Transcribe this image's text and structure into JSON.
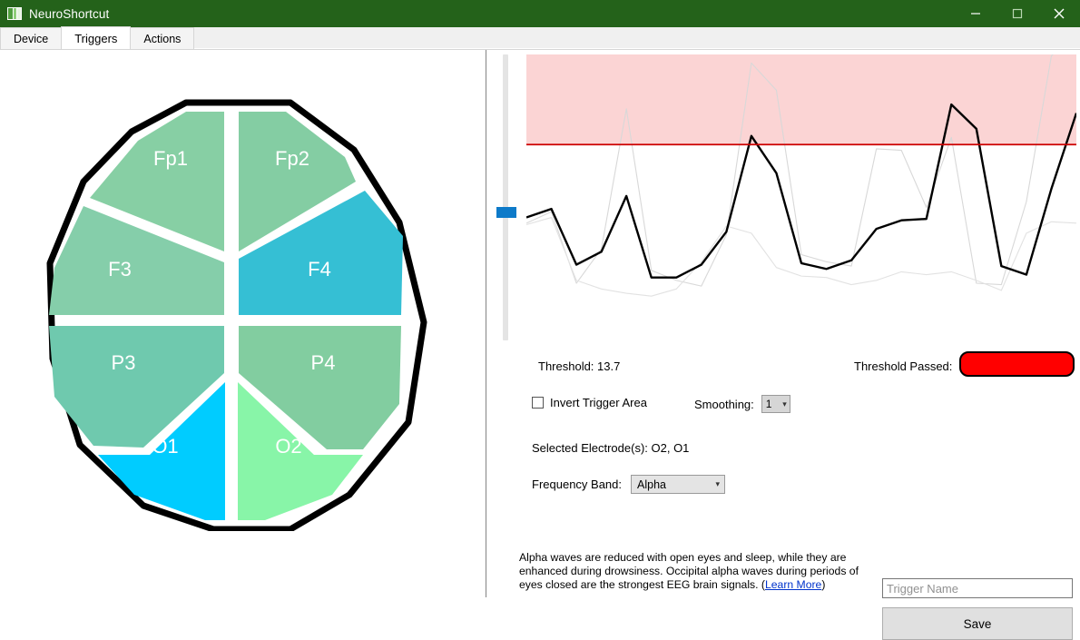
{
  "window": {
    "title": "NeuroShortcut",
    "icon": "app-window-icon",
    "titlebar_color": "#24621a",
    "controls": {
      "minimize": "minimize-icon",
      "maximize": "maximize-icon",
      "close": "close-icon"
    }
  },
  "tabs": [
    {
      "label": "Device",
      "selected": false
    },
    {
      "label": "Triggers",
      "selected": true
    },
    {
      "label": "Actions",
      "selected": false
    }
  ],
  "head_map": {
    "outline_color": "#000000",
    "electrodes": [
      {
        "name": "Fp1",
        "color": "#87cfa4",
        "selected": false
      },
      {
        "name": "Fp2",
        "color": "#84cda3",
        "selected": false
      },
      {
        "name": "F3",
        "color": "#85ceaa",
        "selected": false
      },
      {
        "name": "F4",
        "color": "#35bfd4",
        "selected": false
      },
      {
        "name": "P3",
        "color": "#6fc9ae",
        "selected": false
      },
      {
        "name": "P4",
        "color": "#82cda0",
        "selected": false
      },
      {
        "name": "O1",
        "color": "#00ccff",
        "selected": true
      },
      {
        "name": "O2",
        "color": "#88f5a8",
        "selected": true
      }
    ]
  },
  "chart_data": {
    "type": "line",
    "title": "",
    "xlabel": "",
    "ylabel": "",
    "grid": false,
    "legend": "none",
    "ylim": [
      0,
      20
    ],
    "threshold": 13.7,
    "threshold_line_color": "#cc0000",
    "trigger_area_color": "#fbd4d4",
    "trigger_area_above_threshold": true,
    "series": [
      {
        "name": "signal",
        "color": "#000000",
        "width": 2.4,
        "values": [
          8.6,
          9.2,
          5.3,
          6.2,
          10.1,
          4.4,
          4.4,
          5.3,
          7.6,
          14.3,
          11.7,
          5.4,
          5.0,
          5.6,
          7.8,
          8.4,
          8.5,
          16.5,
          14.8,
          5.2,
          4.6,
          10.6,
          15.9
        ]
      },
      {
        "name": "raw-a",
        "color": "#d8d8d8",
        "width": 1.1,
        "values": [
          8.2,
          9.0,
          4.0,
          6.4,
          16.2,
          4.9,
          4.2,
          3.8,
          7.4,
          19.4,
          17.5,
          6.0,
          5.5,
          5.2,
          13.4,
          13.3,
          9.3,
          14.2,
          4.0,
          3.9,
          9.7,
          19.9,
          21.5
        ]
      },
      {
        "name": "raw-b",
        "color": "#e2e2e2",
        "width": 1.1,
        "values": [
          8.1,
          8.6,
          4.2,
          3.6,
          3.3,
          3.1,
          3.6,
          5.5,
          8.0,
          7.5,
          5.1,
          4.5,
          4.4,
          3.9,
          4.2,
          4.8,
          4.6,
          4.8,
          4.2,
          3.5,
          7.5,
          8.3,
          8.2
        ]
      }
    ]
  },
  "slider": {
    "name": "threshold-slider",
    "value": 13.7,
    "thumb_color": "#0d7ac9",
    "track_color": "#e4e4e4"
  },
  "controls": {
    "threshold_label": "Threshold: 13.7",
    "threshold_passed_label": "Threshold Passed:",
    "indicator_color": "#ff0000",
    "invert_label": "Invert Trigger Area",
    "invert_checked": false,
    "smoothing_label": "Smoothing:",
    "smoothing_value": "1",
    "selected_electrodes_label": "Selected Electrode(s): O2, O1",
    "frequency_band_label": "Frequency Band:",
    "frequency_band_value": "Alpha",
    "description_part1": "Alpha waves are reduced with open eyes and sleep, while they are enhanced during drowsiness. Occipital alpha waves during periods of eyes closed are the strongest EEG brain signals. (",
    "description_link": "Learn More",
    "description_part2": ")",
    "trigger_name_placeholder": "Trigger Name",
    "trigger_name_value": "",
    "save_label": "Save"
  }
}
